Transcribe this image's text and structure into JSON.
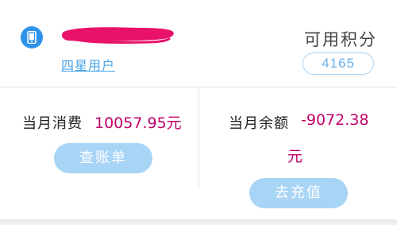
{
  "account": {
    "icon": "phone-icon",
    "member_level": "四星用户"
  },
  "points": {
    "label": "可用积分",
    "value": "4165"
  },
  "consumption": {
    "label": "当月消费",
    "amount": "10057.95元",
    "button": "查账单"
  },
  "balance": {
    "label": "当月余额",
    "amount_line1": "-9072.38",
    "amount_line2": "元",
    "button": "去充值"
  },
  "colors": {
    "accent": "#2f93ea",
    "amount": "#c20068",
    "button": "#a8d4f6",
    "redaction": "#e8126a"
  }
}
